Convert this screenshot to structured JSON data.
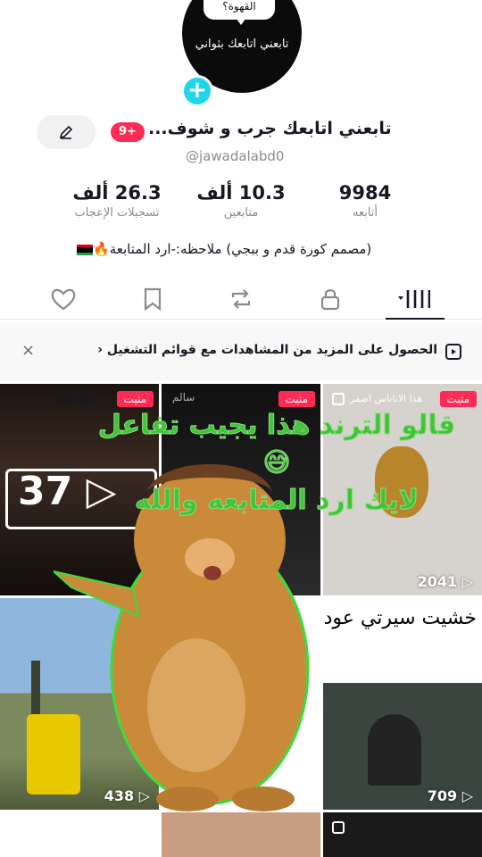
{
  "profile": {
    "avatar_bubble": "القهوة؟",
    "avatar_text": "تابعني اتابعك بثواني",
    "username": "تابعني اتابعك جرب و شوف...",
    "handle": "@jawadalabd0",
    "notification_badge": "9+",
    "bio": "(مصمم كورة قدم و ببجي) ملاحظه:-ارد المتابعة🔥"
  },
  "stats": [
    {
      "value": "9984",
      "label": "أتابعه"
    },
    {
      "value": "10.3 ألف",
      "label": "متابعين"
    },
    {
      "value": "26.3 ألف",
      "label": "تسجيلات الإعجاب"
    }
  ],
  "banner": {
    "text": "الحصول على المزيد من المشاهدات مع قوائم التشغيل ‹",
    "close": "×"
  },
  "grid": {
    "pinned_label": "مثبت",
    "cells": [
      {
        "views": "",
        "pinned": true,
        "caption": "سالم"
      },
      {
        "views": "2041",
        "pinned": true,
        "caption": "هذا الاناناس اصفر"
      },
      {
        "views": "438",
        "pinned": false,
        "caption": ""
      },
      {
        "views": "709",
        "pinned": false,
        "caption": "خشيت سيرتي عودي و انت لب"
      },
      {
        "views": "37",
        "pinned": true,
        "caption": ""
      }
    ]
  },
  "overlay": {
    "line1": "قالو الترند هذا يجيب تفاعل 😅",
    "line2": "لايك ارد المتابعه والله"
  },
  "colors": {
    "accent": "#fe2c55",
    "add_button": "#20d5ec",
    "overlay_text": "#3fc43a"
  }
}
